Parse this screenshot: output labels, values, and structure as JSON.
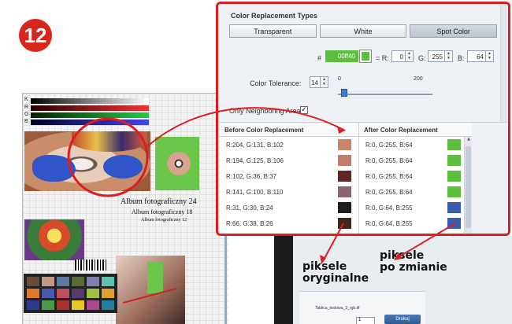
{
  "step_number": "12",
  "background_chart": {
    "row_labels": [
      "K",
      "R",
      "G",
      "B"
    ],
    "album_lines": [
      "Album fotograficzny 24",
      "Album fotograficzny 18",
      "Album fotograficzny 12"
    ],
    "tab_name": "Tablica_testowa_3_rgb.tif",
    "page_value": "1",
    "button_label": "Drukuj"
  },
  "panel": {
    "title": "Color Replacement Types",
    "tabs": [
      {
        "label": "Transparent",
        "active": false
      },
      {
        "label": "White",
        "active": false
      },
      {
        "label": "Spot Color",
        "active": true
      }
    ],
    "hex_prefix": "#",
    "hex_value": "00ff40",
    "spot_color": "#5dbd3c",
    "equals_r_label": "= R:",
    "r_value": "0",
    "g_label": "G:",
    "g_value": "255",
    "b_label": "B:",
    "b_value": "64",
    "tolerance_label": "Color Tolerance:",
    "tolerance_value": "14",
    "slider_min": "0",
    "slider_max": "200",
    "tolerance_fraction": 0.07,
    "neighboring_label": "Only Neighboring Area:",
    "neighboring_checked": true,
    "before_header": "Before Color Replacement",
    "after_header": "After Color Replacement",
    "before_rows": [
      {
        "text": "R:204, G:131, B:102",
        "color": "#cc8366"
      },
      {
        "text": "R:194, G:125, B:106",
        "color": "#c27d6a"
      },
      {
        "text": "R:102, G:36, B:37",
        "color": "#662425"
      },
      {
        "text": "R:141, G:100, B:110",
        "color": "#8d646e"
      },
      {
        "text": "R:31, G:30, B:24",
        "color": "#1f1e18"
      },
      {
        "text": "R:66, G:38, B:26",
        "color": "#42261a"
      }
    ],
    "after_rows": [
      {
        "text": "R:0, G:255, B:64",
        "color": "#5dbd3c"
      },
      {
        "text": "R:0, G:255, B:64",
        "color": "#5dbd3c"
      },
      {
        "text": "R:0, G:255, B:64",
        "color": "#5dbd3c"
      },
      {
        "text": "R:0, G:255, B:64",
        "color": "#5dbd3c"
      },
      {
        "text": "R:0, G:64, B:255",
        "color": "#3a5bb0"
      },
      {
        "text": "R:0, G:64, B:255",
        "color": "#3a5bb0"
      }
    ]
  },
  "annotations": {
    "left_note": [
      "piksele",
      "oryginalne"
    ],
    "right_note": [
      "piksele",
      "po zmianie"
    ],
    "accent_color": "#e11b22"
  }
}
